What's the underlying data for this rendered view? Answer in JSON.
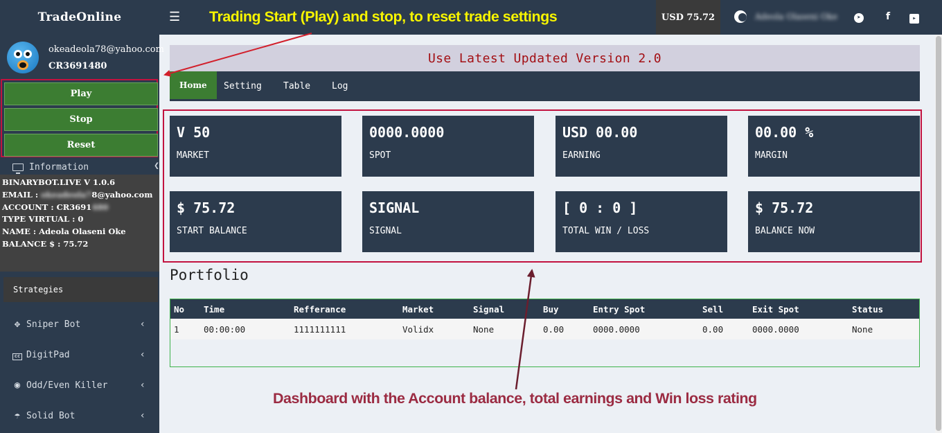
{
  "sidebar": {
    "brand": "TradeOnline",
    "user": {
      "email": "okeadeola78@yahoo.com",
      "account_id": "CR3691480"
    },
    "controls": {
      "play": "Play",
      "stop": "Stop",
      "reset": "Reset"
    },
    "information_label": "Information",
    "info": {
      "version": "BINARYBOT.LIVE V 1.0.6",
      "email_prefix": "EMAIL : ",
      "email_masked": "okeadeola7",
      "email_suffix": "8@yahoo.com",
      "account_prefix": "ACCOUNT : CR3691",
      "account_masked": "480",
      "type": "TYPE VIRTUAL : 0",
      "name": "NAME : Adeola Olaseni Oke",
      "balance": "BALANCE $ : 75.72"
    },
    "strategies_label": "Strategies",
    "nav": [
      {
        "label": "Sniper Bot",
        "icon": "crosshair-icon"
      },
      {
        "label": "DigitPad",
        "icon": "cc-icon"
      },
      {
        "label": "Odd/Even Killer",
        "icon": "globe-icon"
      },
      {
        "label": "Solid Bot",
        "icon": "umbrella-icon"
      }
    ]
  },
  "topbar": {
    "balance_badge": "USD 75.72",
    "user_name": "Adeola Olaseni Oke"
  },
  "main": {
    "banner": "Use Latest Updated Version 2.0",
    "tabs": [
      "Home",
      "Setting",
      "Table",
      "Log"
    ],
    "cards": [
      {
        "value": "V 50",
        "label": "MARKET"
      },
      {
        "value": "0000.0000",
        "label": "SPOT"
      },
      {
        "value": "USD 00.00",
        "label": "EARNING"
      },
      {
        "value": "00.00 %",
        "label": "MARGIN"
      },
      {
        "value": "$ 75.72",
        "label": "START BALANCE"
      },
      {
        "value": "SIGNAL",
        "label": "SIGNAL"
      },
      {
        "value": "[ 0 : 0 ]",
        "label": "TOTAL WIN / LOSS"
      },
      {
        "value": "$ 75.72",
        "label": "BALANCE NOW"
      }
    ],
    "portfolio": {
      "title": "Portfolio",
      "columns": [
        "No",
        "Time",
        "Refferance",
        "Market",
        "Signal",
        "Buy",
        "Entry Spot",
        "Sell",
        "Exit Spot",
        "Status"
      ],
      "rows": [
        [
          "1",
          "00:00:00",
          "1111111111",
          "Volidx",
          "None",
          "0.00",
          "0000.0000",
          "0.00",
          "0000.0000",
          "None"
        ]
      ]
    }
  },
  "annotations": {
    "top": "Trading Start (Play) and stop, to reset trade settings",
    "bottom": "Dashboard with the Account balance, total earnings and Win loss rating"
  },
  "colors": {
    "sidebar_bg": "#2c3b4d",
    "button_green": "#3c7d32",
    "highlight_red": "#c2123f",
    "banner_text": "#a30f14",
    "annotation_yellow": "#f7f400",
    "annotation_maroon": "#9b2b42"
  }
}
